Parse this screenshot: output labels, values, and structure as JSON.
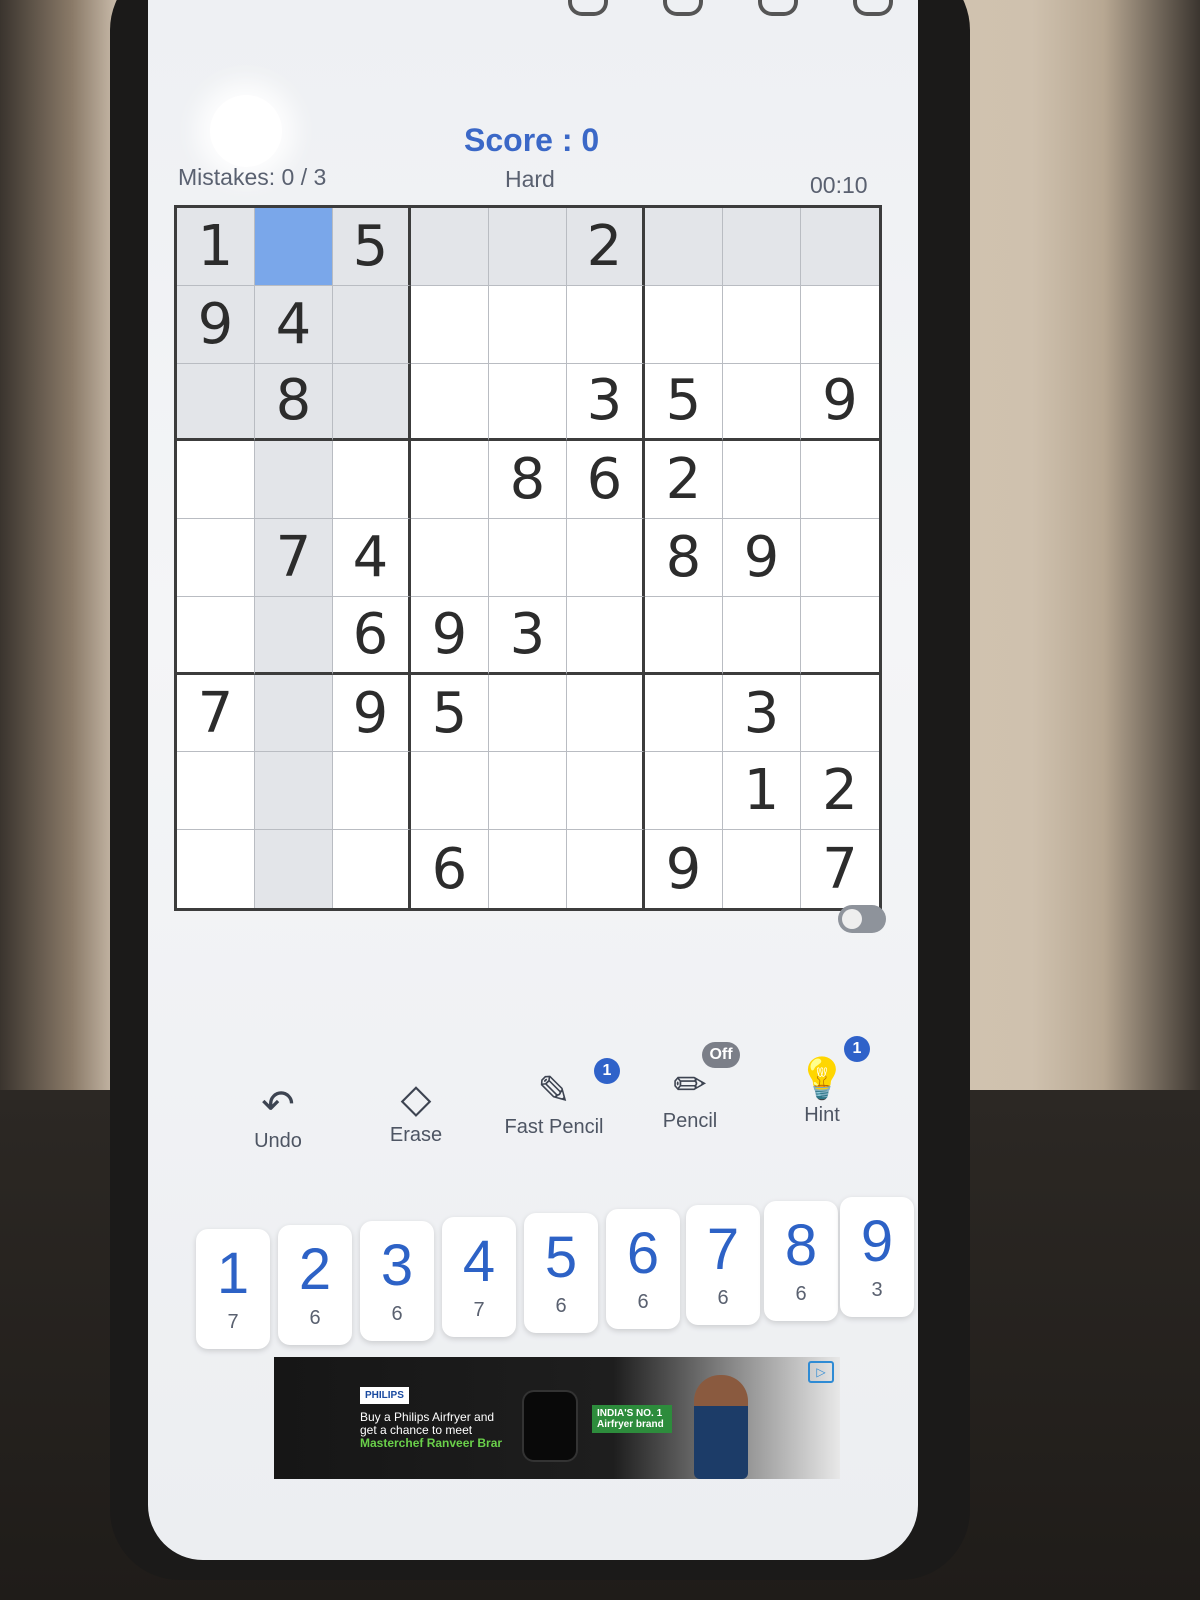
{
  "header": {
    "score": "Score : 0",
    "mistakes": "Mistakes: 0 / 3",
    "difficulty": "Hard",
    "timer": "00:10"
  },
  "board": {
    "rows": [
      [
        "1",
        "",
        "5",
        "",
        "",
        "2",
        "",
        "",
        ""
      ],
      [
        "9",
        "4",
        "",
        "",
        "",
        "",
        "",
        "",
        ""
      ],
      [
        "",
        "8",
        "",
        "",
        "",
        "3",
        "5",
        "",
        "9"
      ],
      [
        "",
        "",
        "",
        "",
        "8",
        "6",
        "2",
        "",
        ""
      ],
      [
        "",
        "7",
        "4",
        "",
        "",
        "",
        "8",
        "9",
        ""
      ],
      [
        "",
        "",
        "6",
        "9",
        "3",
        "",
        "",
        "",
        ""
      ],
      [
        "7",
        "",
        "9",
        "5",
        "",
        "",
        "",
        "3",
        ""
      ],
      [
        "",
        "",
        "",
        "",
        "",
        "",
        "",
        "1",
        "2"
      ],
      [
        "",
        "",
        "",
        "6",
        "",
        "",
        "9",
        "",
        "7"
      ]
    ],
    "selected_cell": "row 1, column 2"
  },
  "tools": [
    {
      "label": "Undo",
      "icon": "undo-icon",
      "badge": ""
    },
    {
      "label": "Erase",
      "icon": "eraser-icon",
      "badge": ""
    },
    {
      "label": "Fast Pencil",
      "icon": "fast-pencil-icon",
      "badge": "1"
    },
    {
      "label": "Pencil",
      "icon": "pencil-icon",
      "badge": "Off"
    },
    {
      "label": "Hint",
      "icon": "lightbulb-icon",
      "badge": "1"
    }
  ],
  "numpad": [
    {
      "num": "1",
      "remaining": "7"
    },
    {
      "num": "2",
      "remaining": "6"
    },
    {
      "num": "3",
      "remaining": "6"
    },
    {
      "num": "4",
      "remaining": "7"
    },
    {
      "num": "5",
      "remaining": "6"
    },
    {
      "num": "6",
      "remaining": "6"
    },
    {
      "num": "7",
      "remaining": "6"
    },
    {
      "num": "8",
      "remaining": "6"
    },
    {
      "num": "9",
      "remaining": "3"
    }
  ],
  "ad": {
    "brand": "PHILIPS",
    "copy_line1": "Buy a Philips Airfryer and",
    "copy_line2": "get a chance to meet",
    "copy_line3": "Masterchef Ranveer Brar",
    "tag": "INDIA'S NO. 1 Airfryer brand"
  },
  "colors": {
    "accent": "#3b68c7",
    "selected_cell": "#7aa7ea",
    "badge": "#2f62c9"
  }
}
